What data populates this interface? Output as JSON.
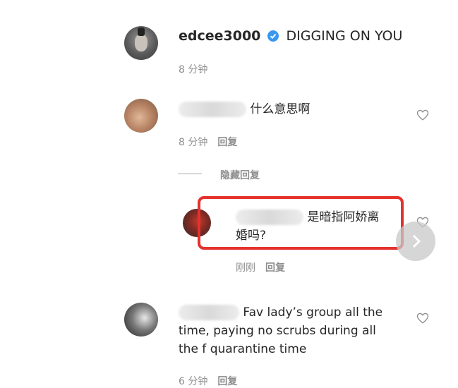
{
  "post": {
    "username": "edcee3000",
    "caption": "DIGGING ON YOU",
    "time": "8 分钟"
  },
  "comments": [
    {
      "text": "什么意思啊",
      "time": "8 分钟",
      "reply_label": "回复",
      "hide_replies_label": "隐藏回复"
    },
    {
      "line1": "是暗指阿娇离",
      "line2": "婚吗?",
      "time": "刚刚",
      "reply_label": "回复"
    },
    {
      "line1": "Fav lady’s group all the",
      "line2": "time, paying no scrubs during all",
      "line3": "the f quarantine time",
      "time": "6 分钟",
      "reply_label": "回复"
    }
  ],
  "colors": {
    "highlight_border": "#e5322d",
    "verified_badge": "#3897f0",
    "muted_text": "#8e8e8e"
  }
}
